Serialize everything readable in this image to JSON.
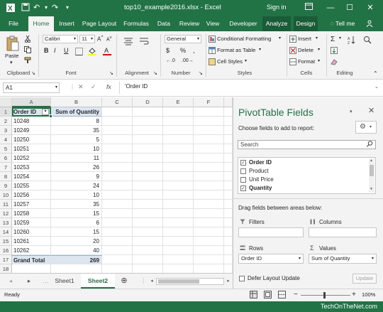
{
  "window": {
    "title": "top10_example2016.xlsx - Excel",
    "sign_in": "Sign in",
    "minimize": "—",
    "restore": "☐",
    "close": "✕"
  },
  "ribbon_tabs": [
    "File",
    "Home",
    "Insert",
    "Page Layout",
    "Formulas",
    "Data",
    "Review",
    "View",
    "Developer",
    "Analyze",
    "Design",
    "Tell me"
  ],
  "ribbon": {
    "clipboard": {
      "paste": "Paste",
      "label": "Clipboard"
    },
    "font": {
      "family": "Calibri",
      "size": "11",
      "label": "Font",
      "bold": "B",
      "italic": "I",
      "underline": "U"
    },
    "alignment": {
      "label": "Alignment"
    },
    "number": {
      "format": "General",
      "currency": "$",
      "percent": "%",
      "comma": ",",
      "label": "Number"
    },
    "styles": {
      "conditional": "Conditional Formatting",
      "table": "Format as Table",
      "cell": "Cell Styles",
      "label": "Styles"
    },
    "cells": {
      "insert": "Insert",
      "delete": "Delete",
      "format": "Format",
      "label": "Cells"
    },
    "editing": {
      "label": "Editing"
    }
  },
  "formula_bar": {
    "name_box": "A1",
    "fx": "fx",
    "content": "'Order ID"
  },
  "grid": {
    "columns": [
      "A",
      "B",
      "C",
      "D",
      "E",
      "F"
    ],
    "row_numbers": [
      "1",
      "2",
      "3",
      "4",
      "5",
      "6",
      "7",
      "8",
      "9",
      "10",
      "11",
      "12",
      "13",
      "14",
      "15",
      "16",
      "17",
      "18"
    ],
    "header": {
      "order_id": "Order ID",
      "sum_qty": "Sum of Quantity"
    },
    "rows": [
      {
        "id": "10248",
        "qty": "8"
      },
      {
        "id": "10249",
        "qty": "35"
      },
      {
        "id": "10250",
        "qty": "5"
      },
      {
        "id": "10251",
        "qty": "10"
      },
      {
        "id": "10252",
        "qty": "11"
      },
      {
        "id": "10253",
        "qty": "26"
      },
      {
        "id": "10254",
        "qty": "9"
      },
      {
        "id": "10255",
        "qty": "24"
      },
      {
        "id": "10256",
        "qty": "10"
      },
      {
        "id": "10257",
        "qty": "35"
      },
      {
        "id": "10258",
        "qty": "15"
      },
      {
        "id": "10259",
        "qty": "6"
      },
      {
        "id": "10260",
        "qty": "15"
      },
      {
        "id": "10261",
        "qty": "20"
      },
      {
        "id": "10262",
        "qty": "40"
      }
    ],
    "total": {
      "label": "Grand Total",
      "value": "269"
    }
  },
  "sheets": [
    "Sheet1",
    "Sheet2"
  ],
  "status": {
    "ready": "Ready",
    "zoom": "100%"
  },
  "pivot_pane": {
    "title": "PivotTable Fields",
    "subtitle": "Choose fields to add to report:",
    "search_placeholder": "Search",
    "fields": [
      {
        "name": "Order ID",
        "checked": true
      },
      {
        "name": "Product",
        "checked": false
      },
      {
        "name": "Unit Price",
        "checked": false
      },
      {
        "name": "Quantity",
        "checked": true
      }
    ],
    "drag_hint": "Drag fields between areas below:",
    "filters": "Filters",
    "columns": "Columns",
    "rows": "Rows",
    "values": "Values",
    "rows_field": "Order ID",
    "values_field": "Sum of Quantity",
    "defer": "Defer Layout Update",
    "update": "Update"
  },
  "watermark": "TechOnTheNet.com",
  "colors": {
    "brand": "#217346",
    "pivot_header": "#dce6f1"
  }
}
